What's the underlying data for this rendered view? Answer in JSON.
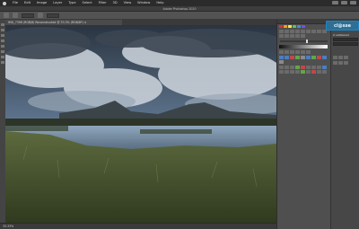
{
  "menubar": {
    "items": [
      "File",
      "Edit",
      "Image",
      "Layer",
      "Type",
      "Select",
      "Filter",
      "3D",
      "View",
      "Window",
      "Help"
    ]
  },
  "title": "Adobe Photoshop 2020",
  "document_tab": "IMG_7396 (RGB/8) Reconstructed @ 33.3% (RGB/8*) ×",
  "status_text": "33.33%",
  "panels": {
    "badge_text": "cl@sse",
    "field_label": "2 orcDocum"
  }
}
